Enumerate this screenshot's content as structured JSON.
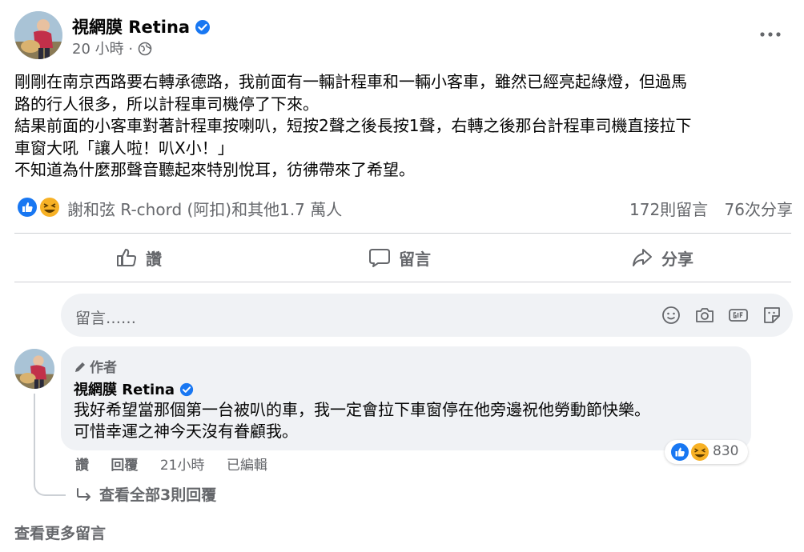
{
  "post": {
    "author": "視網膜 Retina",
    "time": "20 小時",
    "separator": "·",
    "body_lines": [
      "剛剛在南京西路要右轉承德路，我前面有一輛計程車和一輛小客車，雖然已經亮起綠燈，但過馬",
      "路的行人很多，所以計程車司機停了下來。",
      "結果前面的小客車對著計程車按喇叭，短按2聲之後長按1聲，右轉之後那台計程車司機直接拉下",
      "車窗大吼「讓人啦！叭X小！」",
      "不知道為什麼那聲音聽起來特別悅耳，彷彿帶來了希望。"
    ],
    "reactions_text": "謝和弦 R-chord (阿扣)和其他1.7 萬人",
    "comments_count": "172則留言",
    "shares_count": "76次分享"
  },
  "actions": {
    "like": "讚",
    "comment": "留言",
    "share": "分享"
  },
  "comment_input": {
    "placeholder": "留言……"
  },
  "top_comment": {
    "badge": "作者",
    "author": "視網膜 Retina",
    "lines": [
      "我好希望當那個第一台被叭的車，我一定會拉下車窗停在他旁邊祝他勞動節快樂。",
      "可惜幸運之神今天沒有眷顧我。"
    ],
    "reaction_count": "830",
    "like": "讚",
    "reply": "回覆",
    "time": "21小時",
    "edited": "已編輯",
    "view_replies": "查看全部3則回覆"
  },
  "view_more": "查看更多留言",
  "colors": {
    "facebook_blue": "#1877f2",
    "haha_yellow": "#f7b125",
    "secondary_text": "#65676b",
    "bubble_bg": "#f0f2f5"
  },
  "icons": [
    "verified-icon",
    "globe-icon",
    "more-icon",
    "like-reaction-icon",
    "haha-reaction-icon",
    "thumb-icon",
    "comment-icon",
    "share-icon",
    "emoji-icon",
    "camera-icon",
    "gif-icon",
    "sticker-icon",
    "pencil-icon",
    "reply-arrow-icon"
  ]
}
